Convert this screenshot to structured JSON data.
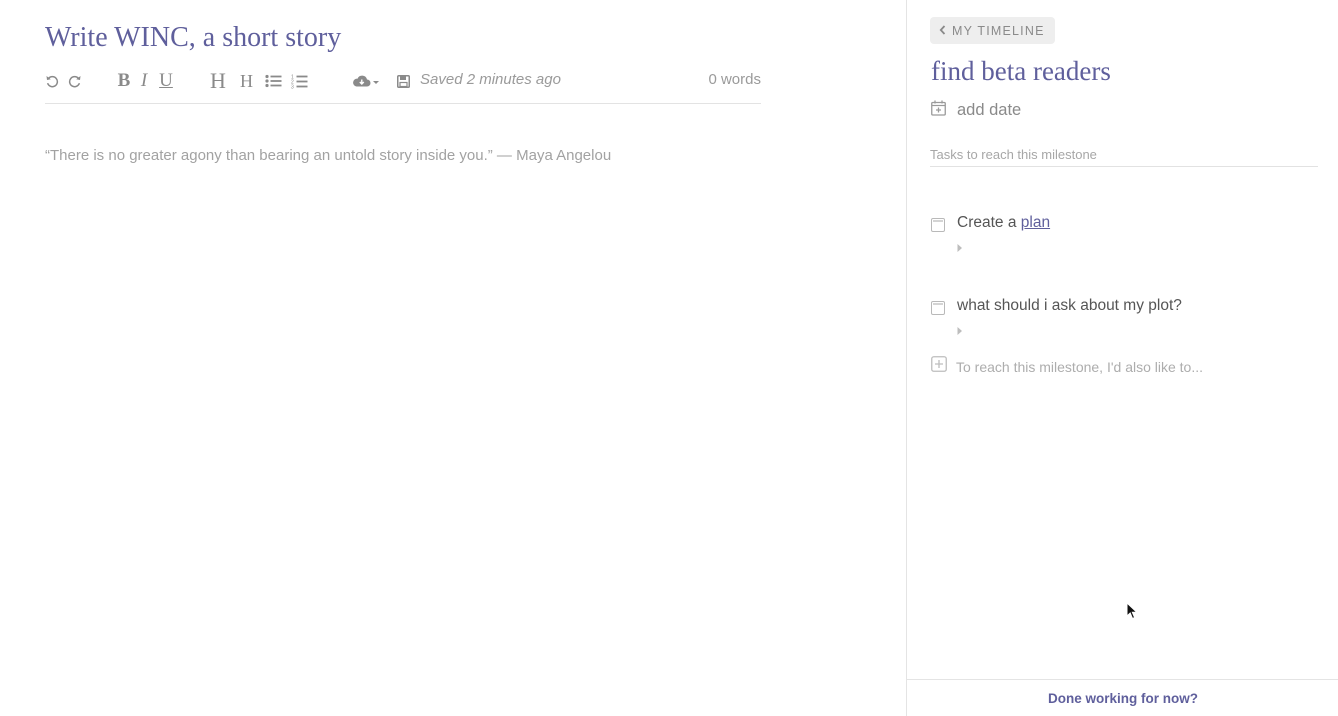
{
  "editor": {
    "title": "Write WINC, a short story",
    "saved_status": "Saved 2 minutes ago",
    "word_count": "0 words",
    "placeholder": "“There is no greater agony than bearing an untold story inside you.” — Maya Angelou",
    "toolbar": {
      "bold": "B",
      "italic": "I",
      "underline": "U",
      "heading_large": "H",
      "heading_small": "H",
      "icons": [
        "undo-icon",
        "redo-icon",
        "bullet-list-icon",
        "numbered-list-icon",
        "cloud-download-icon",
        "caret-down-icon",
        "floppy-disk-icon"
      ]
    }
  },
  "panel": {
    "back_button": "MY TIMELINE",
    "milestone_title": "find beta readers",
    "add_date": "add date",
    "tasks_label": "Tasks to reach this milestone",
    "tasks": [
      {
        "text_prefix": "Create a ",
        "link": "plan",
        "checked": false
      },
      {
        "text": "what should i ask about my plot?",
        "checked": false
      }
    ],
    "add_task_placeholder": "To reach this milestone, I'd also like to...",
    "done_link": "Done working for now?"
  },
  "colors": {
    "accent": "#5f5f9c",
    "muted_text": "#8a8a8a",
    "border": "#e4e4e4"
  }
}
